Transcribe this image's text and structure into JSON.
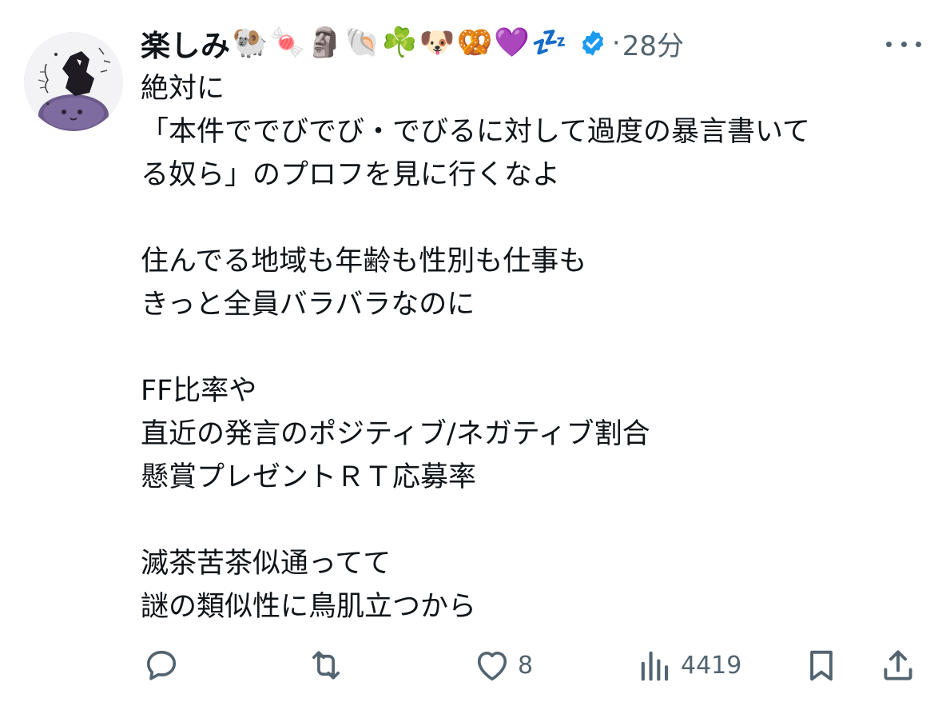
{
  "author": {
    "display_name": "楽しみ",
    "emoji_suffix": "🐏🍬🗿🐚☘️🐶🥨💜💤",
    "verified": true,
    "verified_icon": "verified-badge-icon",
    "separator": "·",
    "time": "28分"
  },
  "tweet": {
    "lines": [
      "絶対に",
      "「本件ででびでび・でびるに対して過度の暴言書いて",
      "る奴ら」のプロフを見に行くなよ",
      "",
      "住んでる地域も年齢も性別も仕事も",
      "きっと全員バラバラなのに",
      "",
      "FF比率や",
      "直近の発言のポジティブ/ネガティブ割合",
      "懸賞プレゼントＲＴ応募率",
      "",
      "滅茶苦茶似通ってて",
      "謎の類似性に鳥肌立つから"
    ]
  },
  "actions": {
    "reply": {
      "icon": "reply-icon",
      "count": ""
    },
    "retweet": {
      "icon": "retweet-icon",
      "count": ""
    },
    "like": {
      "icon": "heart-icon",
      "count": "8"
    },
    "views": {
      "icon": "views-icon",
      "count": "4419"
    },
    "bookmark": {
      "icon": "bookmark-icon"
    },
    "share": {
      "icon": "share-icon"
    }
  },
  "colors": {
    "text": "#0f1419",
    "secondary": "#536471",
    "verified": "#1d9bf0"
  }
}
